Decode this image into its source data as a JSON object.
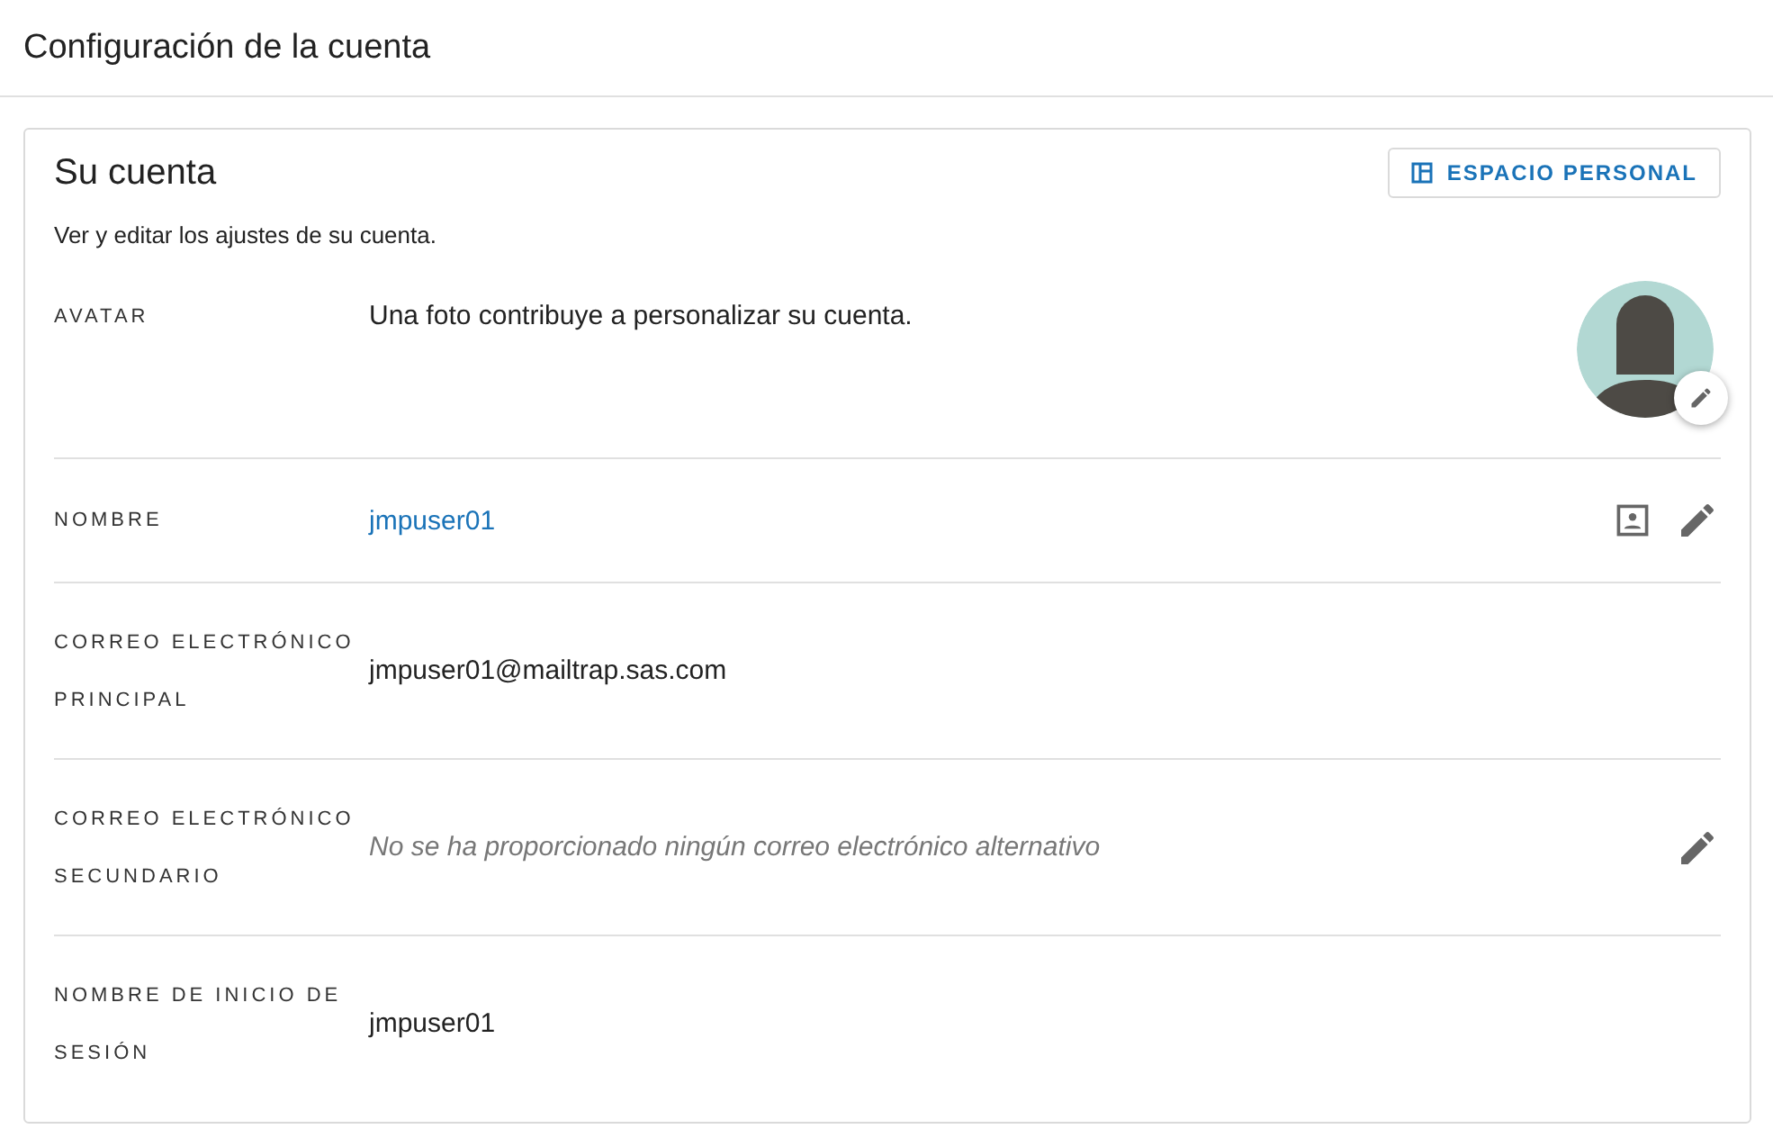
{
  "page_title": "Configuración de la cuenta",
  "card": {
    "title": "Su cuenta",
    "subtitle": "Ver y editar los ajustes de su cuenta.",
    "workspace_button": "ESPACIO PERSONAL",
    "rows": [
      {
        "kind": "avatar",
        "label": "AVATAR",
        "value": "Una foto contribuye a personalizar su cuenta.",
        "editable": true
      },
      {
        "kind": "link",
        "label": "NOMBRE",
        "value": "jmpuser01",
        "editable": true,
        "contact_card": true
      },
      {
        "kind": "text",
        "label": "CORREO ELECTRÓNICO PRINCIPAL",
        "value": "jmpuser01@mailtrap.sas.com",
        "editable": false,
        "contact_card": false
      },
      {
        "kind": "empty",
        "label": "CORREO ELECTRÓNICO SECUNDARIO",
        "value": "No se ha proporcionado ningún correo electrónico alternativo",
        "editable": true,
        "contact_card": false
      },
      {
        "kind": "text",
        "label": "NOMBRE DE INICIO DE SESIÓN",
        "value": "jmpuser01",
        "editable": false,
        "contact_card": false
      }
    ]
  }
}
